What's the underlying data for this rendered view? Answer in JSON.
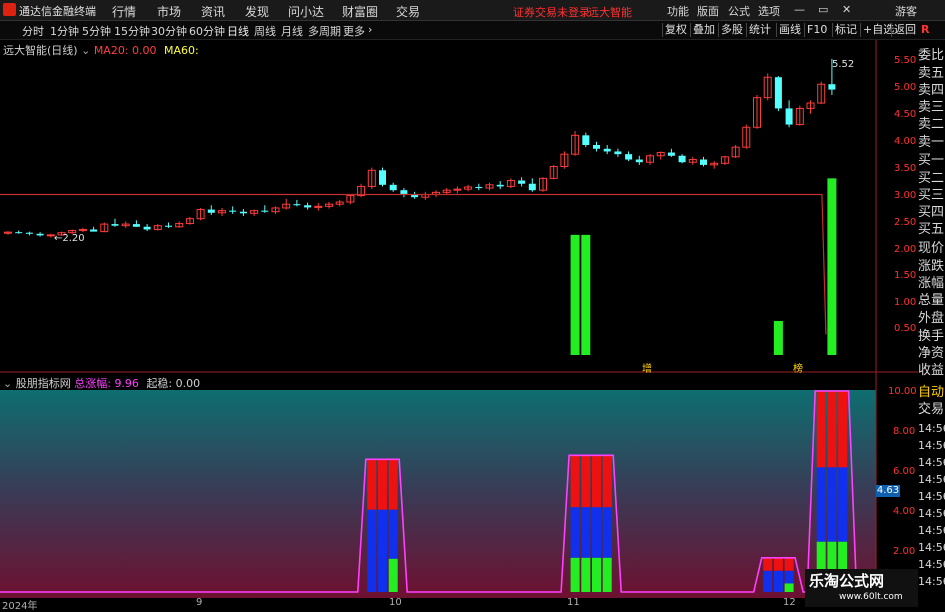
{
  "app": {
    "title": "通达信金融终端",
    "menu": [
      "行情",
      "市场",
      "资讯",
      "发现",
      "问小达",
      "财富圈",
      "交易"
    ],
    "warning": "证券交易未登录",
    "stock_link": "远大智能",
    "right_menu": [
      "功能",
      "版面",
      "公式",
      "选项"
    ],
    "user": "游客",
    "window_controls": [
      "—",
      "▭",
      "✕"
    ]
  },
  "toolbar": {
    "periods": [
      "分时",
      "1分钟",
      "5分钟",
      "15分钟",
      "30分钟",
      "60分钟",
      "日线",
      "周线",
      "月线",
      "多周期",
      "更多"
    ],
    "active_period": "日线",
    "right_buttons": [
      "复权",
      "叠加",
      "多股",
      "统计",
      "画线",
      "F10",
      "标记",
      "+自选",
      "返回"
    ]
  },
  "main_chart": {
    "name": "远大智能(日线)",
    "ma20_label": "MA20:",
    "ma20_value": "0.00",
    "ma60_label": "MA60:",
    "price_high_label": "5.52",
    "price_low_label": "2.20",
    "y_ticks": [
      "5.50",
      "5.00",
      "4.50",
      "4.00",
      "3.50",
      "3.00",
      "2.50",
      "2.00",
      "1.50",
      "1.00",
      "0.50"
    ],
    "markers": [
      "增",
      "榜"
    ],
    "candles": [
      [
        2.28,
        2.32,
        2.25,
        2.3
      ],
      [
        2.3,
        2.33,
        2.27,
        2.29
      ],
      [
        2.29,
        2.31,
        2.24,
        2.27
      ],
      [
        2.27,
        2.3,
        2.22,
        2.24
      ],
      [
        2.24,
        2.27,
        2.2,
        2.25
      ],
      [
        2.25,
        2.31,
        2.23,
        2.29
      ],
      [
        2.29,
        2.35,
        2.27,
        2.33
      ],
      [
        2.33,
        2.38,
        2.3,
        2.35
      ],
      [
        2.35,
        2.4,
        2.32,
        2.31
      ],
      [
        2.31,
        2.48,
        2.3,
        2.45
      ],
      [
        2.45,
        2.55,
        2.4,
        2.42
      ],
      [
        2.42,
        2.5,
        2.38,
        2.45
      ],
      [
        2.45,
        2.52,
        2.4,
        2.4
      ],
      [
        2.4,
        2.45,
        2.32,
        2.35
      ],
      [
        2.35,
        2.45,
        2.33,
        2.42
      ],
      [
        2.42,
        2.48,
        2.38,
        2.4
      ],
      [
        2.4,
        2.5,
        2.38,
        2.46
      ],
      [
        2.46,
        2.58,
        2.44,
        2.55
      ],
      [
        2.55,
        2.75,
        2.52,
        2.72
      ],
      [
        2.72,
        2.8,
        2.62,
        2.66
      ],
      [
        2.66,
        2.75,
        2.6,
        2.7
      ],
      [
        2.7,
        2.78,
        2.64,
        2.68
      ],
      [
        2.68,
        2.73,
        2.6,
        2.65
      ],
      [
        2.65,
        2.72,
        2.6,
        2.7
      ],
      [
        2.7,
        2.8,
        2.66,
        2.68
      ],
      [
        2.68,
        2.78,
        2.64,
        2.75
      ],
      [
        2.75,
        2.92,
        2.72,
        2.82
      ],
      [
        2.82,
        2.9,
        2.78,
        2.8
      ],
      [
        2.8,
        2.85,
        2.72,
        2.76
      ],
      [
        2.76,
        2.84,
        2.7,
        2.78
      ],
      [
        2.78,
        2.86,
        2.74,
        2.82
      ],
      [
        2.82,
        2.9,
        2.78,
        2.86
      ],
      [
        2.86,
        3.0,
        2.82,
        2.98
      ],
      [
        2.98,
        3.2,
        2.95,
        3.15
      ],
      [
        3.15,
        3.5,
        3.1,
        3.45
      ],
      [
        3.45,
        3.5,
        3.15,
        3.18
      ],
      [
        3.18,
        3.22,
        3.05,
        3.08
      ],
      [
        3.08,
        3.12,
        2.95,
        3.0
      ],
      [
        3.0,
        3.05,
        2.92,
        2.95
      ],
      [
        2.95,
        3.05,
        2.9,
        3.0
      ],
      [
        3.0,
        3.08,
        2.95,
        3.04
      ],
      [
        3.04,
        3.12,
        3.0,
        3.08
      ],
      [
        3.08,
        3.15,
        3.02,
        3.1
      ],
      [
        3.1,
        3.18,
        3.06,
        3.14
      ],
      [
        3.14,
        3.2,
        3.08,
        3.12
      ],
      [
        3.12,
        3.22,
        3.08,
        3.18
      ],
      [
        3.18,
        3.25,
        3.1,
        3.15
      ],
      [
        3.15,
        3.3,
        3.12,
        3.26
      ],
      [
        3.26,
        3.32,
        3.15,
        3.2
      ],
      [
        3.2,
        3.3,
        3.05,
        3.08
      ],
      [
        3.08,
        3.32,
        3.05,
        3.3
      ],
      [
        3.3,
        3.55,
        3.28,
        3.52
      ],
      [
        3.52,
        3.8,
        3.48,
        3.75
      ],
      [
        3.75,
        4.18,
        3.72,
        4.1
      ],
      [
        4.1,
        4.15,
        3.88,
        3.92
      ],
      [
        3.92,
        3.98,
        3.8,
        3.85
      ],
      [
        3.85,
        3.92,
        3.75,
        3.8
      ],
      [
        3.8,
        3.85,
        3.7,
        3.75
      ],
      [
        3.75,
        3.8,
        3.62,
        3.65
      ],
      [
        3.65,
        3.72,
        3.55,
        3.6
      ],
      [
        3.6,
        3.75,
        3.55,
        3.72
      ],
      [
        3.72,
        3.8,
        3.65,
        3.78
      ],
      [
        3.78,
        3.85,
        3.7,
        3.72
      ],
      [
        3.72,
        3.75,
        3.58,
        3.6
      ],
      [
        3.6,
        3.7,
        3.55,
        3.65
      ],
      [
        3.65,
        3.7,
        3.52,
        3.55
      ],
      [
        3.55,
        3.62,
        3.48,
        3.58
      ],
      [
        3.58,
        3.72,
        3.55,
        3.7
      ],
      [
        3.7,
        3.92,
        3.68,
        3.88
      ],
      [
        3.88,
        4.3,
        3.85,
        4.25
      ],
      [
        4.25,
        4.85,
        4.22,
        4.8
      ],
      [
        4.8,
        5.25,
        4.75,
        5.18
      ],
      [
        5.18,
        5.2,
        4.55,
        4.6
      ],
      [
        4.6,
        4.75,
        4.25,
        4.3
      ],
      [
        4.3,
        4.65,
        4.28,
        4.6
      ],
      [
        4.6,
        4.75,
        4.5,
        4.7
      ],
      [
        4.7,
        5.1,
        4.68,
        5.05
      ],
      [
        5.05,
        5.52,
        4.85,
        4.95
      ]
    ],
    "red_line_level": 3.0,
    "volume_bars": [
      {
        "index": 53,
        "value": 2.25
      },
      {
        "index": 54,
        "value": 2.25
      },
      {
        "index": 72,
        "value": 0.65
      },
      {
        "index": 77,
        "value": 3.3
      }
    ]
  },
  "indicator": {
    "name": "股朋指标网",
    "total_label": "总涨幅:",
    "total_value": "9.96",
    "start_label": "起稳:",
    "start_value": "0.00",
    "y_ticks": [
      "10.00",
      "8.00",
      "6.00",
      "4.00",
      "2.00"
    ],
    "current_value": "4.63",
    "peaks": [
      {
        "start": 34,
        "end": 36,
        "height": 6.6
      },
      {
        "start": 53,
        "end": 56,
        "height": 6.8
      },
      {
        "start": 71,
        "end": 73,
        "height": 1.7
      },
      {
        "start": 76,
        "end": 78,
        "height": 10.0
      }
    ]
  },
  "sidepanel": {
    "items": [
      "委比",
      "卖五",
      "卖四",
      "卖三",
      "卖二",
      "卖一",
      "买一",
      "买二",
      "买三",
      "买四",
      "买五",
      "现价",
      "涨跌",
      "涨幅",
      "总量",
      "外盘",
      "换手",
      "净资",
      "收益"
    ],
    "lower_items": [
      "自动",
      "交易"
    ],
    "times": [
      "14:56",
      "14:56",
      "14:56",
      "14:56",
      "14:56",
      "14:56",
      "14:56",
      "14:56",
      "14:56",
      "14:56"
    ]
  },
  "bottom_axis": {
    "dates": [
      "2024年",
      "9",
      "10",
      "11",
      "12"
    ]
  },
  "watermark": {
    "name": "乐淘公式网",
    "url": "www.60lt.com"
  }
}
